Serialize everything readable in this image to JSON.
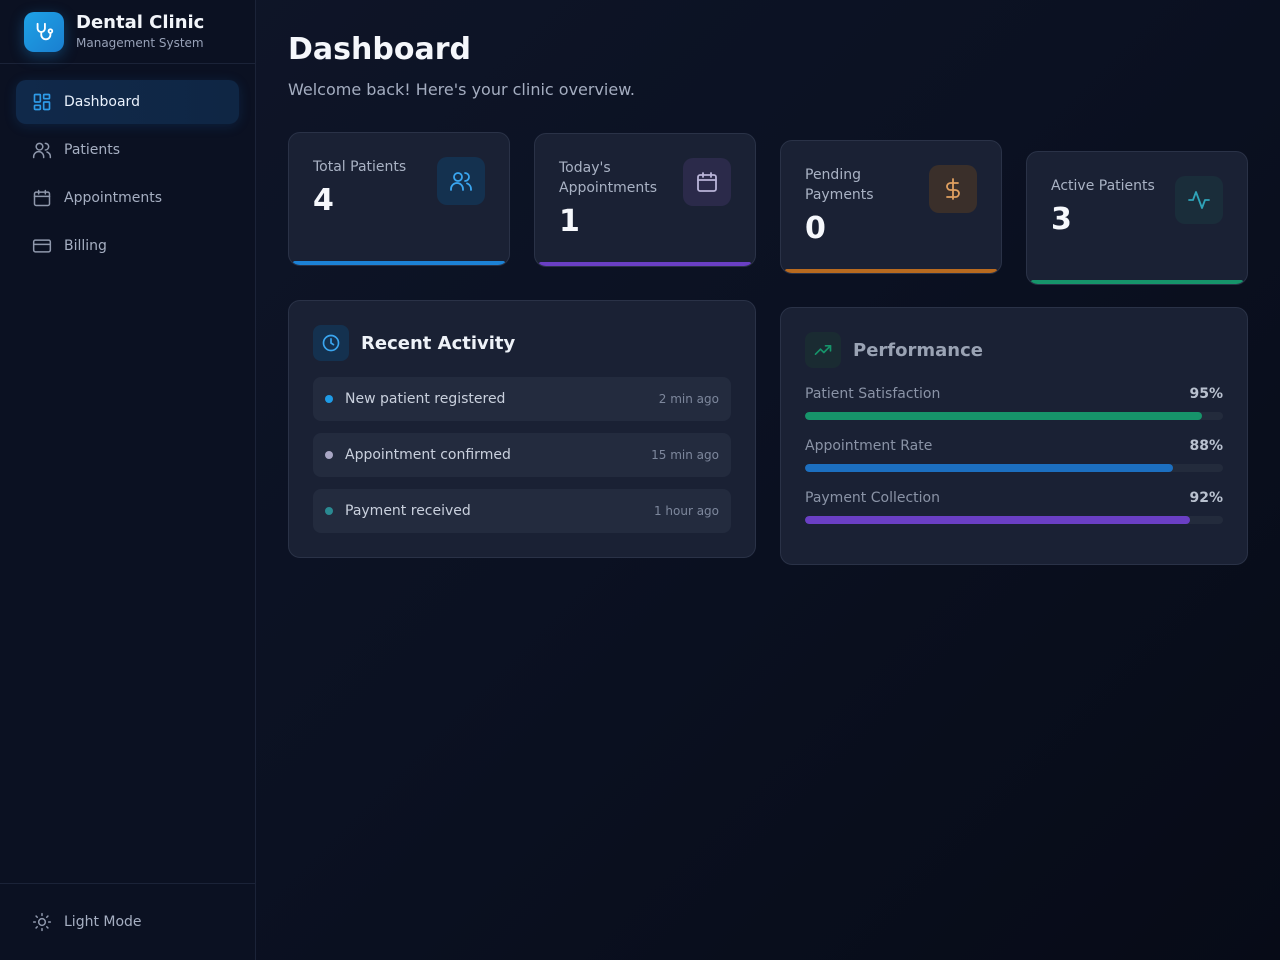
{
  "brand": {
    "title": "Dental Clinic",
    "subtitle": "Management System",
    "logo_icon": "stethoscope-icon"
  },
  "nav": {
    "items": [
      {
        "label": "Dashboard",
        "icon": "layout-grid-icon",
        "active": true
      },
      {
        "label": "Patients",
        "icon": "users-icon",
        "active": false
      },
      {
        "label": "Appointments",
        "icon": "calendar-icon",
        "active": false
      },
      {
        "label": "Billing",
        "icon": "credit-card-icon",
        "active": false
      }
    ],
    "footer": {
      "label": "Light Mode",
      "icon": "sun-icon"
    }
  },
  "header": {
    "title": "Dashboard",
    "subtitle": "Welcome back! Here's your clinic overview."
  },
  "stats": [
    {
      "label": "Total Patients",
      "value": "4",
      "icon": "users-icon",
      "accent": "#1c82d6"
    },
    {
      "label": "Today's Appointments",
      "value": "1",
      "icon": "calendar-icon",
      "accent": "#6a3fc4"
    },
    {
      "label": "Pending Payments",
      "value": "0",
      "icon": "dollar-icon",
      "accent": "#b86a1f"
    },
    {
      "label": "Active Patients",
      "value": "3",
      "icon": "activity-icon",
      "accent": "#16946a"
    }
  ],
  "recent_activity": {
    "title": "Recent Activity",
    "icon": "clock-icon",
    "items": [
      {
        "text": "New patient registered",
        "time": "2 min ago",
        "dot_color": "#1e9be6"
      },
      {
        "text": "Appointment confirmed",
        "time": "15 min ago",
        "dot_color": "#a8a6c4"
      },
      {
        "text": "Payment received",
        "time": "1 hour ago",
        "dot_color": "#2a8a92"
      }
    ]
  },
  "performance": {
    "title": "Performance",
    "icon": "trending-up-icon",
    "metrics": [
      {
        "label": "Patient Satisfaction",
        "value": "95%",
        "percent": 95,
        "color": "#16946a"
      },
      {
        "label": "Appointment Rate",
        "value": "88%",
        "percent": 88,
        "color": "#1c6fc0"
      },
      {
        "label": "Payment Collection",
        "value": "92%",
        "percent": 92,
        "color": "#6a3fc4"
      }
    ]
  }
}
